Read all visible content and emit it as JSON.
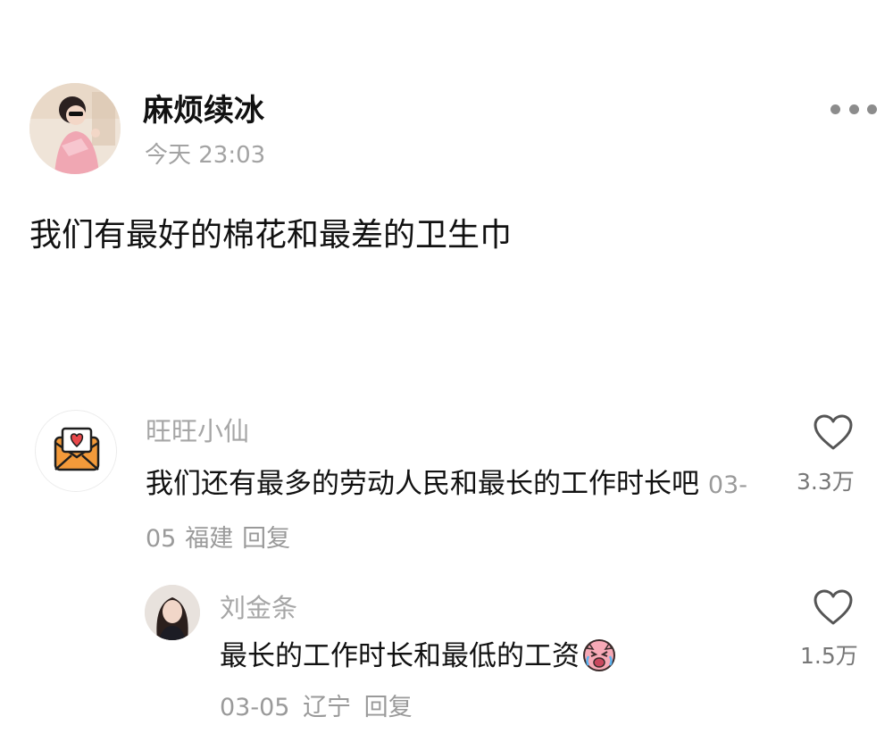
{
  "post": {
    "author": "麻烦续冰",
    "time": "今天 23:03",
    "content": "我们有最好的棉花和最差的卫生巾",
    "more_icon": "more-horizontal-icon"
  },
  "comments": [
    {
      "name": "旺旺小仙",
      "text": "我们还有最多的劳动人民和最长的工作时长吧",
      "date": "03-05",
      "location": "福建",
      "reply_label": "回复",
      "likes": "3.3万",
      "avatar_icon": "heart-envelope-icon"
    },
    {
      "name": "刘金条",
      "text": "最长的工作时长和最低的工资",
      "emoji": "crying-pig-emoji-icon",
      "date": "03-05",
      "location": "辽宁",
      "reply_label": "回复",
      "likes": "1.5万"
    }
  ],
  "colors": {
    "meta_gray": "#a6a6a6",
    "text_dark": "#111111",
    "envelope_orange": "#f39a3a",
    "heart_red": "#e8474a"
  }
}
